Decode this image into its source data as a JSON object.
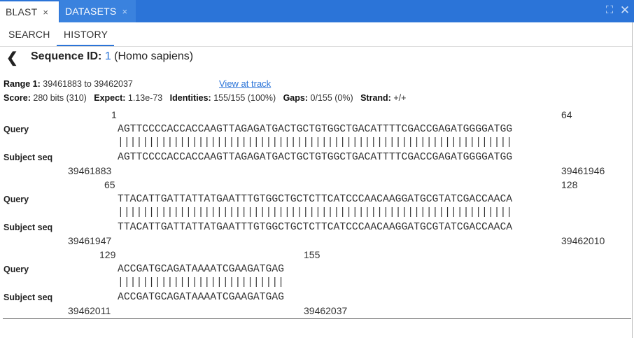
{
  "tabs": [
    {
      "label": "BLAST",
      "close": "×"
    },
    {
      "label": "DATASETS",
      "close": "×"
    }
  ],
  "window_controls": {
    "expand": "⛶",
    "close": "✕"
  },
  "subtabs": [
    {
      "label": "SEARCH"
    },
    {
      "label": "HISTORY"
    }
  ],
  "active_subtab": "HISTORY",
  "header": {
    "back": "❮",
    "seq_label": "Sequence ID:",
    "seq_id": "1",
    "organism": "(Homo sapiens)"
  },
  "range": {
    "label": "Range 1:",
    "value": "39461883 to 39462037",
    "link": "View at track"
  },
  "stats": [
    {
      "label": "Score:",
      "value": "280 bits (310)"
    },
    {
      "label": "Expect:",
      "value": "1.13e-73"
    },
    {
      "label": "Identities:",
      "value": "155/155 (100%)"
    },
    {
      "label": "Gaps:",
      "value": "0/155 (0%)"
    },
    {
      "label": "Strand:",
      "value": "+/+"
    }
  ],
  "alignment": {
    "query_label": "Query",
    "subject_label": "Subject seq",
    "blocks": [
      {
        "q_start": "1",
        "q_end": "64",
        "query": "AGTTCCCCACCACCAAGTTAGAGATGACTGCTGTGGCTGACATTTTCGACCGAGATGGGGATGG",
        "match": "||||||||||||||||||||||||||||||||||||||||||||||||||||||||||||||||",
        "subject": "AGTTCCCCACCACCAAGTTAGAGATGACTGCTGTGGCTGACATTTTCGACCGAGATGGGGATGG",
        "s_start": "39461883",
        "s_end": "39461946"
      },
      {
        "q_start": "65",
        "q_end": "128",
        "query": "TTACATTGATTATTATGAATTTGTGGCTGCTCTTCATCCCAACAAGGATGCGTATCGACCAACA",
        "match": "||||||||||||||||||||||||||||||||||||||||||||||||||||||||||||||||",
        "subject": "TTACATTGATTATTATGAATTTGTGGCTGCTCTTCATCCCAACAAGGATGCGTATCGACCAACA",
        "s_start": "39461947",
        "s_end": "39462010"
      },
      {
        "q_start": "129",
        "q_end": "155",
        "query": "ACCGATGCAGATAAAATCGAAGATGAG",
        "match": "|||||||||||||||||||||||||||",
        "subject": "ACCGATGCAGATAAAATCGAAGATGAG",
        "s_start": "39462011",
        "s_end": "39462037"
      }
    ]
  }
}
